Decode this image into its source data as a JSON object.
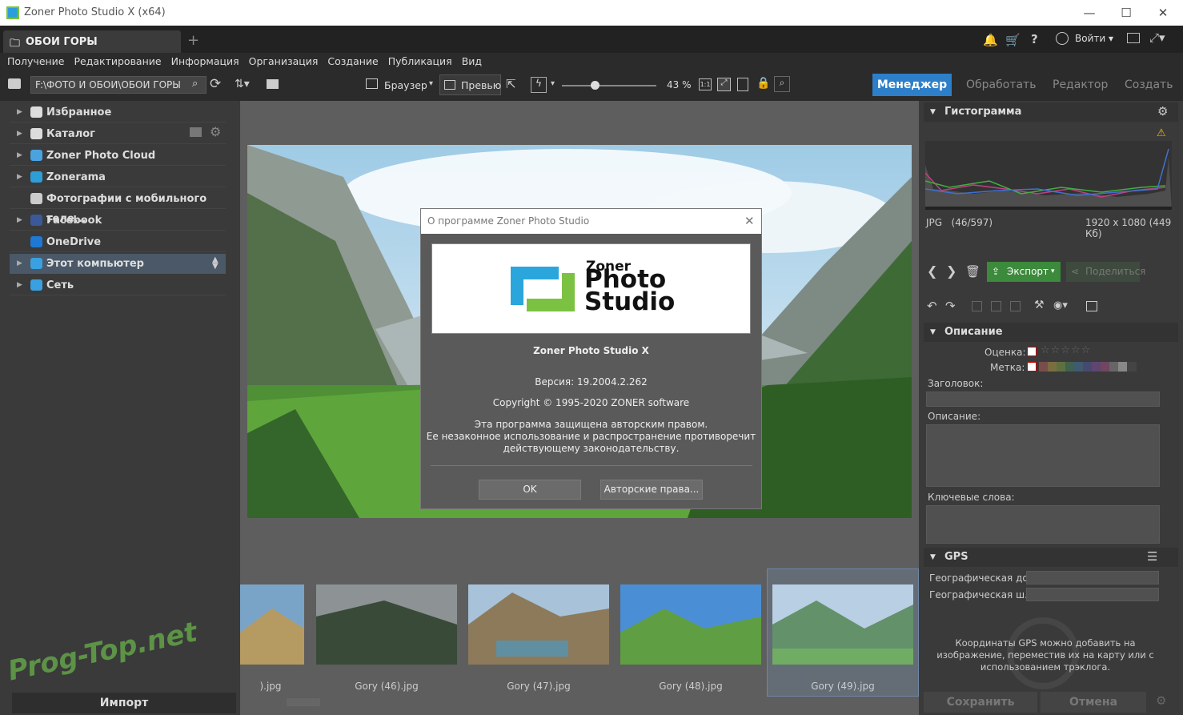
{
  "window": {
    "title": "Zoner Photo Studio X (x64)",
    "minimize": "—",
    "maximize": "☐",
    "close": "✕"
  },
  "tab": {
    "label": "ОБОИ ГОРЫ",
    "add": "+"
  },
  "header_right": {
    "login": "Войти"
  },
  "menu": [
    "Получение",
    "Редактирование",
    "Информация",
    "Организация",
    "Создание",
    "Публикация",
    "Вид"
  ],
  "toolbar": {
    "path": "F:\\ФОТО И ОБОИ\\ОБОИ ГОРЫ",
    "browser": "Браузер",
    "preview": "Превью",
    "zoom": "43 %",
    "zoom_fraction": 0.35
  },
  "modes": [
    "Менеджер",
    "Обработать",
    "Редактор",
    "Создать"
  ],
  "nav": [
    {
      "label": "Избранное",
      "arrow": true,
      "color": "#ddd"
    },
    {
      "label": "Каталог",
      "arrow": true,
      "color": "#ddd"
    },
    {
      "label": "Zoner Photo Cloud",
      "arrow": true,
      "color": "#4aa3df"
    },
    {
      "label": "Zonerama",
      "arrow": true,
      "color": "#2d9fd8"
    },
    {
      "label": "Фотографии с мобильного теле...",
      "arrow": false,
      "color": "#ccc"
    },
    {
      "label": "Facebook",
      "arrow": true,
      "color": "#3b5998"
    },
    {
      "label": "OneDrive",
      "arrow": false,
      "color": "#1e78d4"
    },
    {
      "label": "Этот компьютер",
      "arrow": true,
      "color": "#3aa0e0"
    },
    {
      "label": "Сеть",
      "arrow": true,
      "color": "#3aa0e0"
    }
  ],
  "import_label": "Импорт",
  "thumbs": [
    {
      "caption": ").jpg"
    },
    {
      "caption": "Gory (46).jpg"
    },
    {
      "caption": "Gory (47).jpg"
    },
    {
      "caption": "Gory (48).jpg"
    },
    {
      "caption": "Gory (49).jpg"
    }
  ],
  "watermark": "Prog-Top.net",
  "dialog": {
    "title": "О программе Zoner Photo Studio",
    "logo_line1": "Zoner",
    "logo_line2": "Photo",
    "logo_line3": "Studio",
    "product": "Zoner Photo Studio X",
    "version": "Версия: 19.2004.2.262",
    "copyright": "Copyright © 1995-2020 ZONER software",
    "legal1": "Эта программа защищена авторским правом.",
    "legal2": "Ее незаконное использование и распространение противоречит",
    "legal3": "действующему законодательству.",
    "ok": "OK",
    "rights": "Авторские права..."
  },
  "panel": {
    "histogram": "Гистограмма",
    "format": "JPG",
    "index": "(46/597)",
    "dims": "1920 x 1080 (449 Кб)",
    "export": "Экспорт",
    "share": "Поделиться",
    "description_section": "Описание",
    "rating": "Оценка:",
    "label": "Метка:",
    "heading": "Заголовок:",
    "description": "Описание:",
    "keywords": "Ключевые слова:",
    "gps": "GPS",
    "geo1": "Географическая до...",
    "geo2": "Географическая ш...",
    "gps_note1": "Координаты GPS можно добавить на",
    "gps_note2": "изображение, переместив их на карту или с",
    "gps_note3": "использованием трэклога.",
    "save": "Сохранить",
    "cancel": "Отмена"
  },
  "colors": {
    "accent": "#2d7fc9",
    "export_green": "#3c8a3c"
  }
}
